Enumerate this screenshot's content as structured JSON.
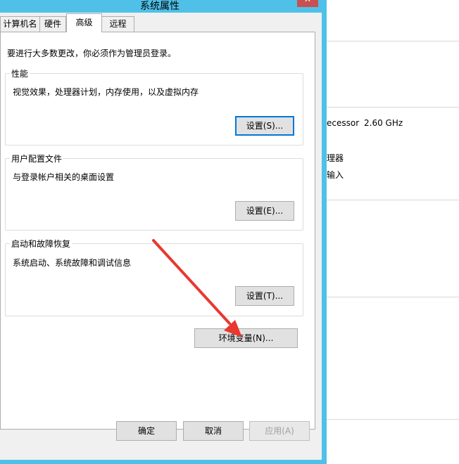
{
  "dialog": {
    "title": "系统属性",
    "close_glyph": "✕",
    "tabs": [
      {
        "label": "计算机名"
      },
      {
        "label": "硬件"
      },
      {
        "label": "高级"
      },
      {
        "label": "远程"
      }
    ],
    "notice": "要进行大多数更改，你必须作为管理员登录。",
    "performance": {
      "title": "性能",
      "description": "视觉效果，处理器计划，内存使用，以及虚拟内存",
      "button": "设置(S)..."
    },
    "user_profiles": {
      "title": "用户配置文件",
      "description": "与登录帐户相关的桌面设置",
      "button": "设置(E)..."
    },
    "startup_recovery": {
      "title": "启动和故障恢复",
      "description": "系统启动、系统故障和调试信息",
      "button": "设置(T)..."
    },
    "env_button": "环境变量(N)...",
    "ok": "确定",
    "cancel": "取消",
    "apply": "应用(A)"
  },
  "background_window": {
    "processor_fragment": "ecessor",
    "processor_speed": "2.60 GHz",
    "line2": "理器",
    "line3": "输入"
  },
  "colors": {
    "title_bar": "#4fc1e9",
    "close_button": "#c75050",
    "arrow": "#e8382f"
  }
}
